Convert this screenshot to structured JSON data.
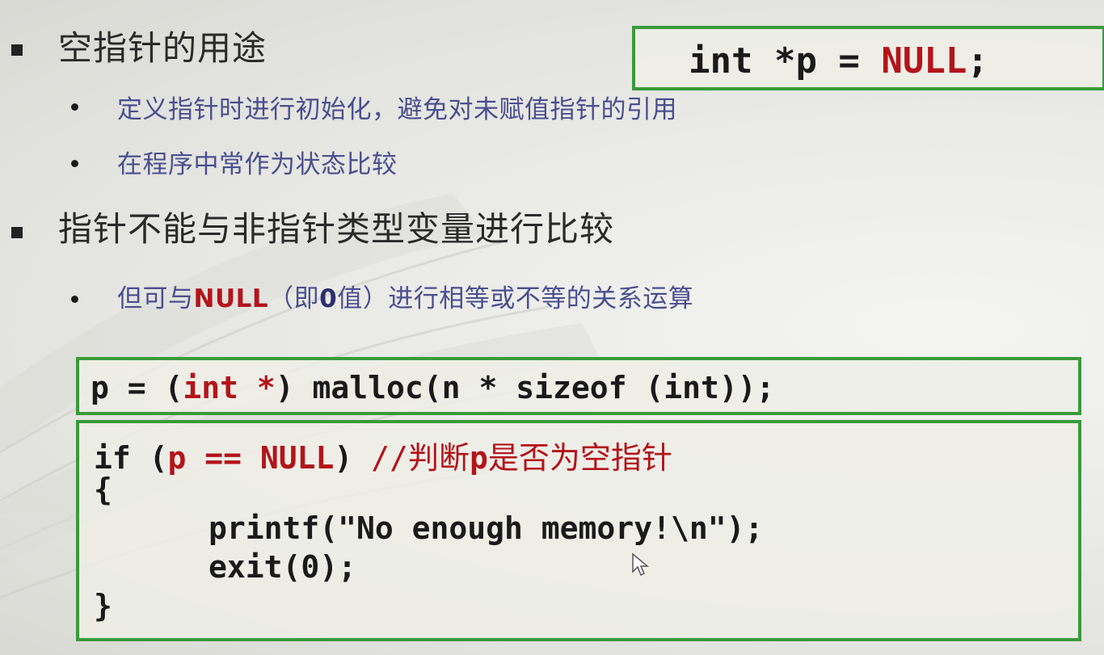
{
  "heading1": "空指针的用途",
  "sub1": [
    "定义指针时进行初始化，避免对未赋值指针的引用",
    "在程序中常作为状态比较"
  ],
  "heading2": "指针不能与非指针类型变量进行比较",
  "sub2": {
    "pre": "但可与",
    "null_kw": "NULL",
    "mid": "（即",
    "zero": "0",
    "post": "值）进行相等或不等的关系运算"
  },
  "code_null": {
    "a": "int *p = ",
    "null": "NULL",
    "b": ";"
  },
  "code_malloc": {
    "a": "p = (",
    "cast": "int *",
    "b": ") malloc(n * sizeof (int));"
  },
  "code_if": {
    "l1_if": "if (",
    "l1_cond": "p == NULL",
    "l1_close": ") ",
    "l1_slashes": "//",
    "l1_comment_a": "判断",
    "l1_comment_p": "p",
    "l1_comment_b": "是否为空指针",
    "l2": "{",
    "l3": "printf(\"No enough memory!\\n\");",
    "l4": "exit(0);",
    "l5": "}"
  },
  "colors": {
    "keyword_red": "#b3141a",
    "sub_text": "#4a4f8f",
    "box_border": "#3a9a3a"
  }
}
